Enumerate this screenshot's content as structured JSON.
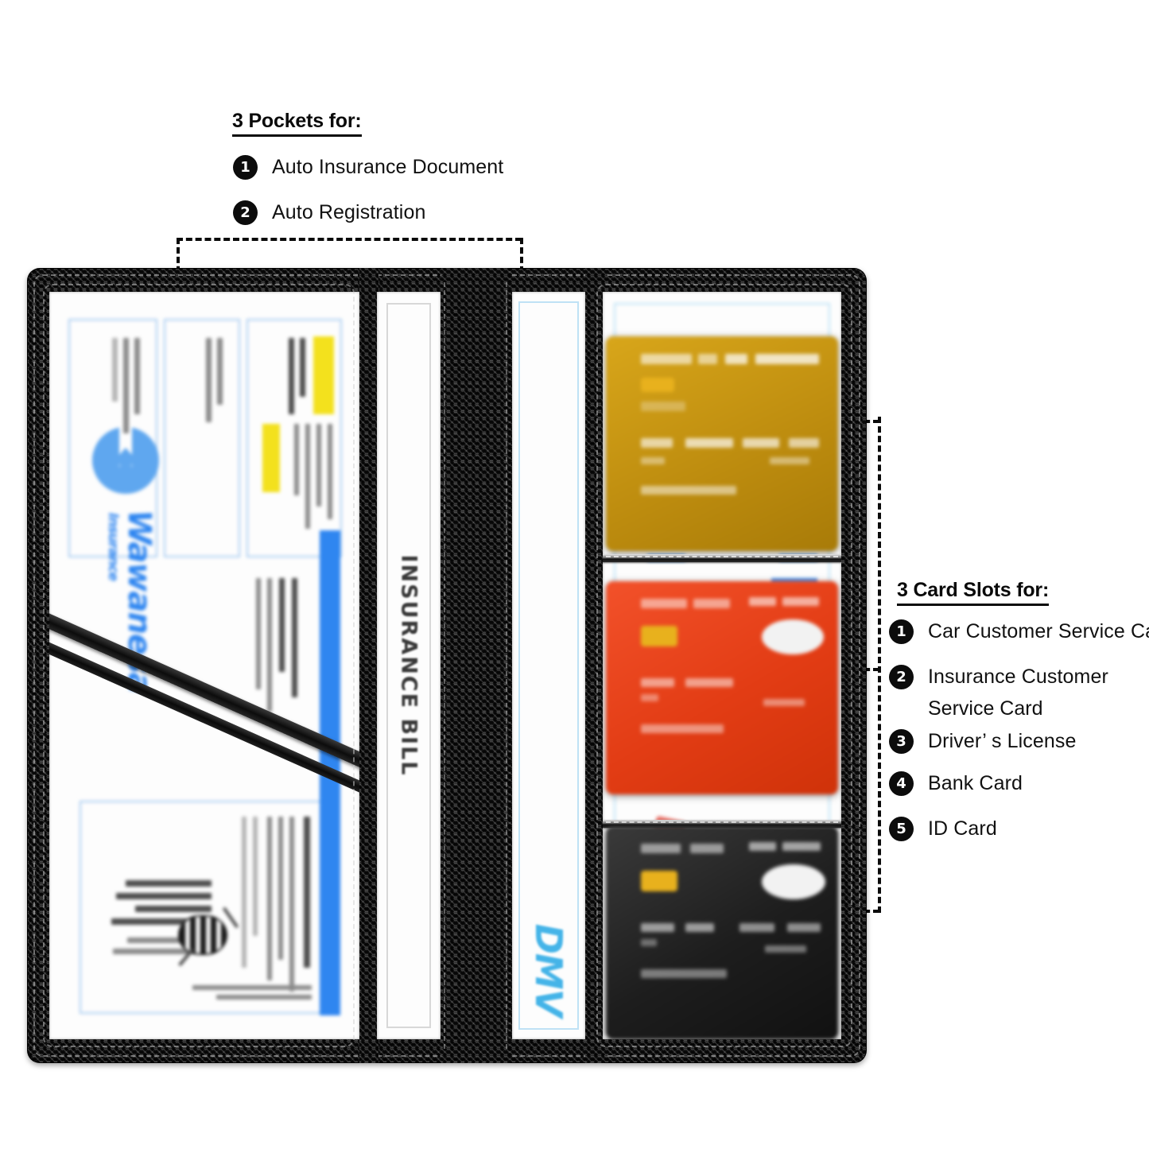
{
  "pockets_callout": {
    "heading": "3 Pockets for:",
    "items": [
      {
        "num": "1",
        "label": "Auto Insurance Document"
      },
      {
        "num": "2",
        "label": "Auto Registration"
      }
    ]
  },
  "cards_callout": {
    "heading": "3 Card Slots for:",
    "items": [
      {
        "num": "1",
        "label": "Car Customer Service Card",
        "label_line2": ""
      },
      {
        "num": "2",
        "label": "Insurance Customer",
        "label_line2": "Service Card"
      },
      {
        "num": "3",
        "label": "Driver’ s License",
        "label_line2": ""
      },
      {
        "num": "4",
        "label": "Bank Card",
        "label_line2": ""
      },
      {
        "num": "5",
        "label": "ID Card",
        "label_line2": ""
      }
    ]
  },
  "product": {
    "type": "carbon-fiber-document-wallet",
    "shell_color": "#141414",
    "left_pocket": {
      "document_name": "INSURANCE BILL",
      "brand": "Wawanesa",
      "brand_sub": "Insurance",
      "brand_color": "#2f86f0",
      "highlight_color": "#f3e11d",
      "mark": "bee-emblem"
    },
    "middle_pocket": {
      "spine_label": "INSURANCE BILL"
    },
    "right_pocket": {
      "document_name": "DMV",
      "document_color": "#45b4e8"
    },
    "card_slots": [
      {
        "slot": "1",
        "card_color": "#c49212",
        "card_name": "gold-card"
      },
      {
        "slot": "2",
        "card_color": "#e8421a",
        "card_name": "red-card"
      },
      {
        "slot": "3",
        "card_color": "#1c1c1c",
        "card_name": "black-card"
      }
    ]
  }
}
